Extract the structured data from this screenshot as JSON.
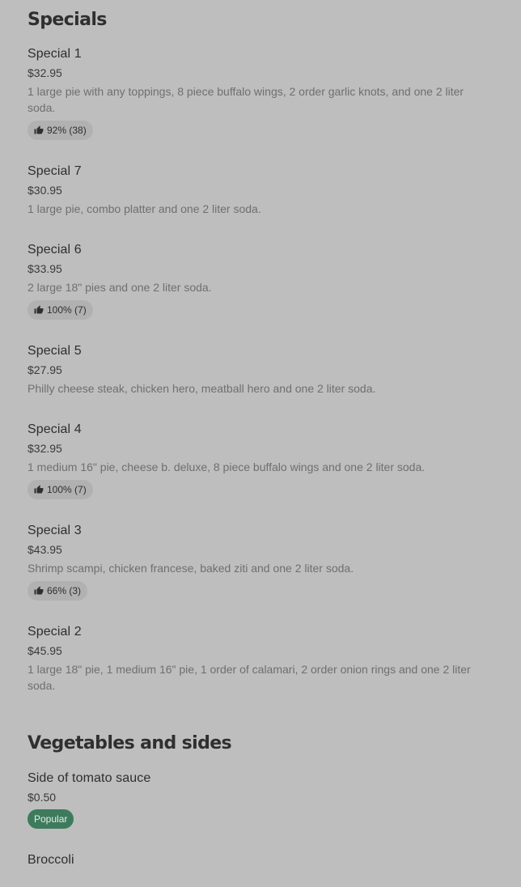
{
  "specials": {
    "title": "Specials",
    "items": [
      {
        "name": "Special 1",
        "price": "$32.95",
        "desc": "1 large pie with any toppings, 8 piece buffalo wings, 2 order garlic knots, and one 2 liter soda.",
        "rating": "92% (38)"
      },
      {
        "name": "Special 7",
        "price": "$30.95",
        "desc": "1 large pie, combo platter and one 2 liter soda.",
        "rating": null
      },
      {
        "name": "Special 6",
        "price": "$33.95",
        "desc": "2 large 18\" pies and one 2 liter soda.",
        "rating": "100% (7)"
      },
      {
        "name": "Special 5",
        "price": "$27.95",
        "desc": "Philly cheese steak, chicken hero, meatball hero and one 2 liter soda.",
        "rating": null
      },
      {
        "name": "Special 4",
        "price": "$32.95",
        "desc": "1 medium 16\" pie, cheese b. deluxe, 8 piece buffalo wings and one 2 liter soda.",
        "rating": "100% (7)"
      },
      {
        "name": "Special 3",
        "price": "$43.95",
        "desc": "Shrimp scampi, chicken francese, baked ziti and one 2 liter soda.",
        "rating": "66% (3)"
      },
      {
        "name": "Special 2",
        "price": "$45.95",
        "desc": "1 large 18\" pie, 1 medium 16\" pie, 1 order of calamari, 2 order onion rings and one 2 liter soda.",
        "rating": null
      }
    ]
  },
  "vegetables": {
    "title": "Vegetables and sides",
    "items": [
      {
        "name": "Side of tomato sauce",
        "price": "$0.50",
        "tag": "Popular"
      },
      {
        "name": "Broccoli"
      }
    ]
  },
  "colors": {
    "background": "#bebebe",
    "popular_badge": "#3e7b5c",
    "rating_badge": "#b1b1b1"
  },
  "icons": {
    "rating": "thumbs-up-icon"
  }
}
